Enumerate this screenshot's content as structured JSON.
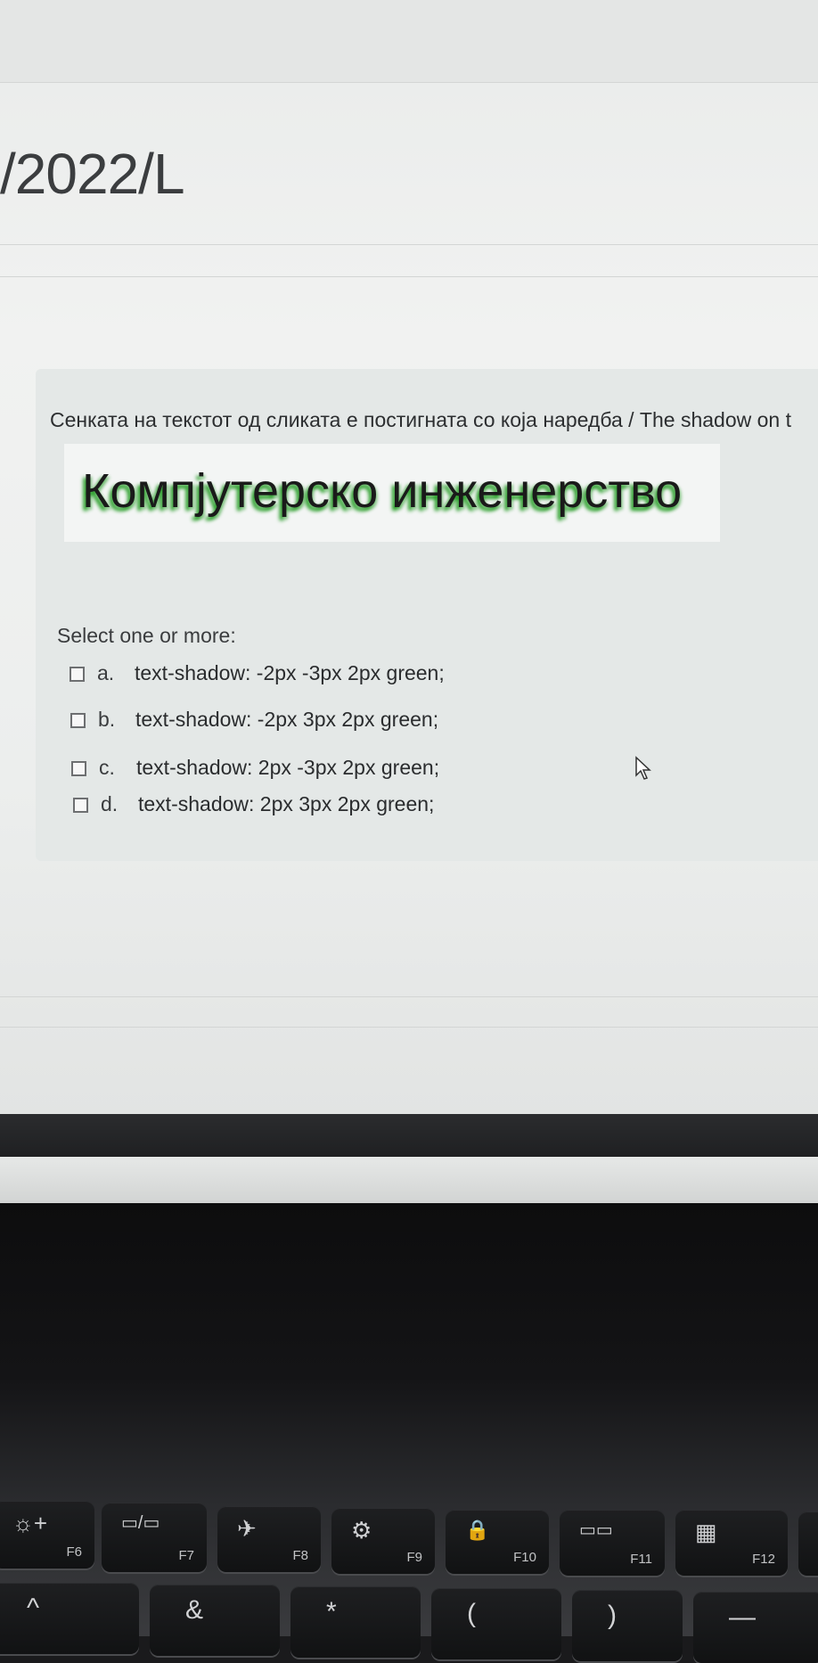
{
  "page": {
    "course_title": "/2022/L"
  },
  "question": {
    "text": "Сенката на текстот од сликата е постигната со која наредба / The shadow on t",
    "image_text": "Компјутерско инженерство",
    "select_label": "Select one or more:",
    "options": [
      {
        "letter": "a.",
        "label": "text-shadow: -2px -3px 2px green;",
        "checked": false
      },
      {
        "letter": "b.",
        "label": "text-shadow: -2px 3px 2px green;",
        "checked": false
      },
      {
        "letter": "c.",
        "label": "text-shadow: 2px -3px 2px green;",
        "checked": false
      },
      {
        "letter": "d.",
        "label": "text-shadow: 2px 3px 2px green;",
        "checked": false
      }
    ]
  },
  "keyboard": {
    "function_keys": [
      {
        "label": "F6",
        "icon": "brightness-up-icon",
        "glyph": "☼+"
      },
      {
        "label": "F7",
        "icon": "display-switch-icon",
        "glyph": "▭/▭"
      },
      {
        "label": "F8",
        "icon": "airplane-mode-icon",
        "glyph": "✈"
      },
      {
        "label": "F9",
        "icon": "settings-icon",
        "glyph": "⚙"
      },
      {
        "label": "F10",
        "icon": "lock-icon",
        "glyph": "🔒"
      },
      {
        "label": "F11",
        "icon": "keyboard-backlight-icon",
        "glyph": "▭▭"
      },
      {
        "label": "F12",
        "icon": "calculator-icon",
        "glyph": "▦"
      }
    ],
    "number_row_symbols": [
      "^",
      "&",
      "*",
      "(",
      ")",
      "—"
    ]
  }
}
